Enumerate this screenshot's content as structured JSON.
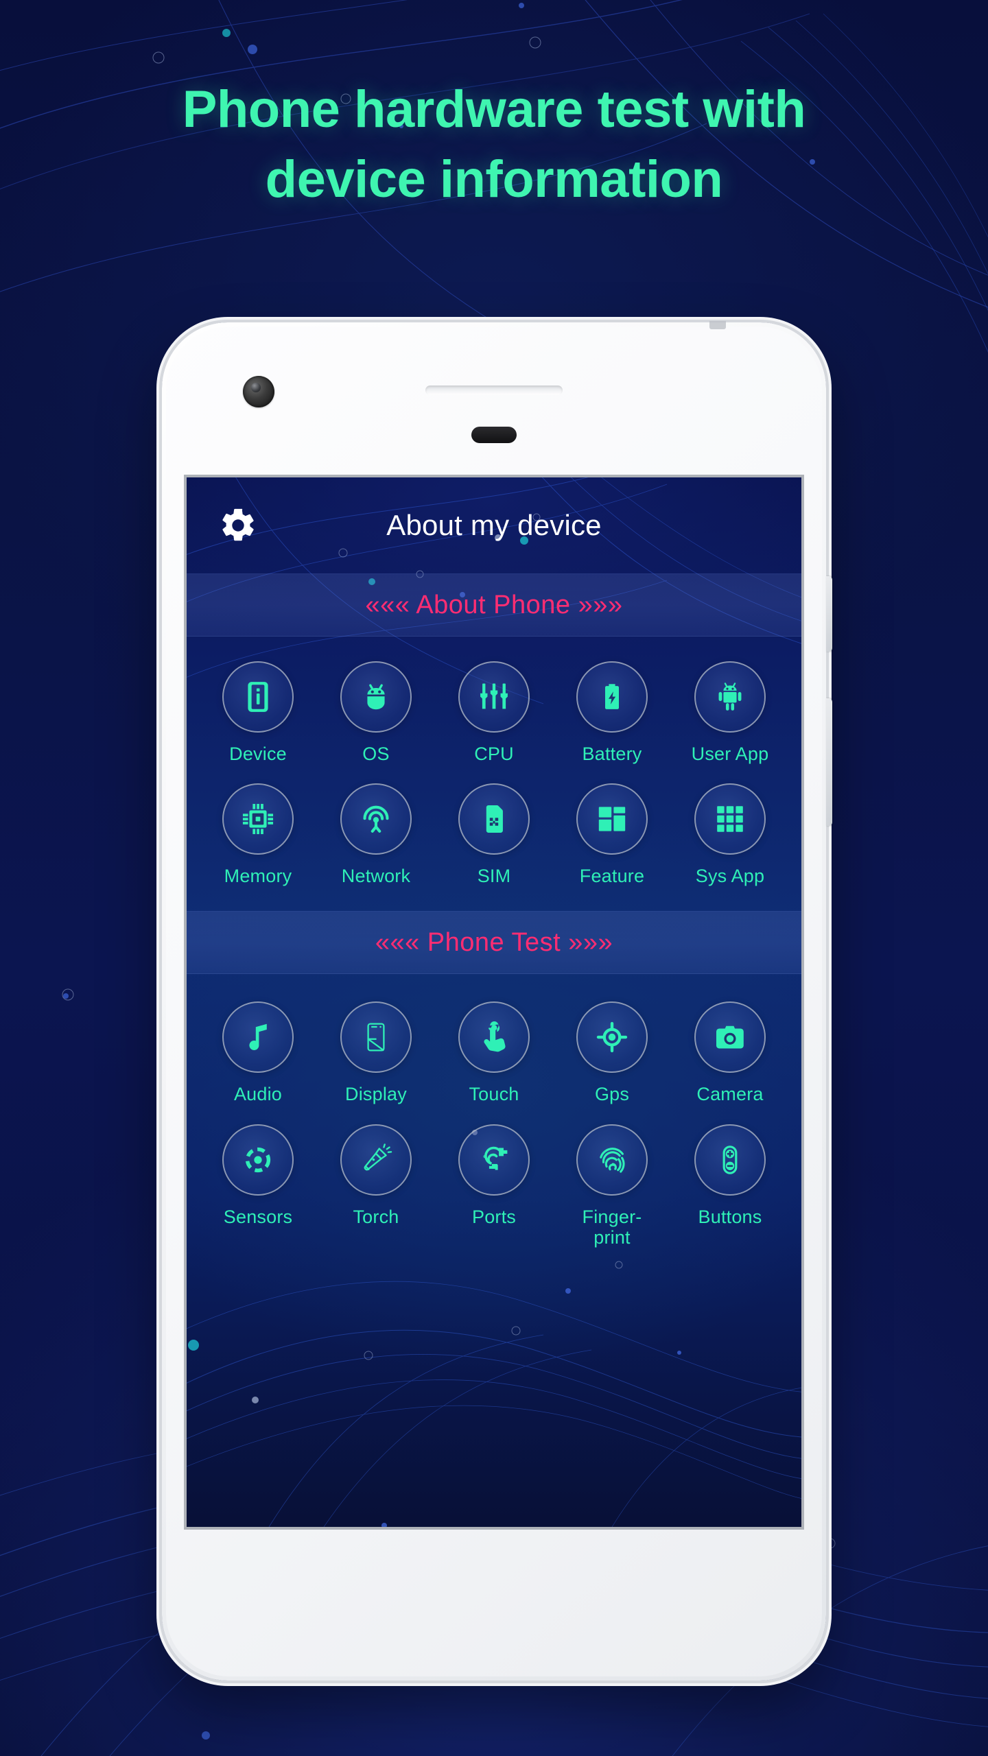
{
  "promo": {
    "headline_line1": "Phone hardware test with",
    "headline_line2": "device information",
    "headline_color": "#3ff5b0",
    "background_color": "#0a1246"
  },
  "app": {
    "appbar": {
      "icon": "gear-icon",
      "title": "About my device",
      "title_color": "#ffffff"
    },
    "sections": [
      {
        "id": "about-phone",
        "band_label": "««« About Phone »»»",
        "band_color": "#ff2d72",
        "tiles": [
          {
            "label": "Device",
            "icon": "device-info-icon"
          },
          {
            "label": "OS",
            "icon": "android-head-icon"
          },
          {
            "label": "CPU",
            "icon": "cpu-sliders-icon"
          },
          {
            "label": "Battery",
            "icon": "battery-bolt-icon"
          },
          {
            "label": "User App",
            "icon": "android-robot-icon"
          },
          {
            "label": "Memory",
            "icon": "memory-chip-icon"
          },
          {
            "label": "Network",
            "icon": "network-antenna-icon"
          },
          {
            "label": "SIM",
            "icon": "sim-card-icon"
          },
          {
            "label": "Feature",
            "icon": "feature-grid-icon"
          },
          {
            "label": "Sys App",
            "icon": "apps-grid-icon"
          }
        ]
      },
      {
        "id": "phone-test",
        "band_label": "««« Phone Test »»»",
        "band_color": "#ff2d72",
        "tiles": [
          {
            "label": "Audio",
            "icon": "music-note-icon"
          },
          {
            "label": "Display",
            "icon": "display-screen-icon"
          },
          {
            "label": "Touch",
            "icon": "touch-hand-icon"
          },
          {
            "label": "Gps",
            "icon": "gps-crosshair-icon"
          },
          {
            "label": "Camera",
            "icon": "camera-icon"
          },
          {
            "label": "Sensors",
            "icon": "sensors-dashed-circle-icon"
          },
          {
            "label": "Torch",
            "icon": "flashlight-icon"
          },
          {
            "label": "Ports",
            "icon": "usb-cable-icon"
          },
          {
            "label": "Finger-\nprint",
            "icon": "fingerprint-icon"
          },
          {
            "label": "Buttons",
            "icon": "volume-buttons-icon"
          }
        ]
      }
    ],
    "tile_label_color": "#2ff0b6",
    "tile_icon_color": "#2ff0b6"
  }
}
